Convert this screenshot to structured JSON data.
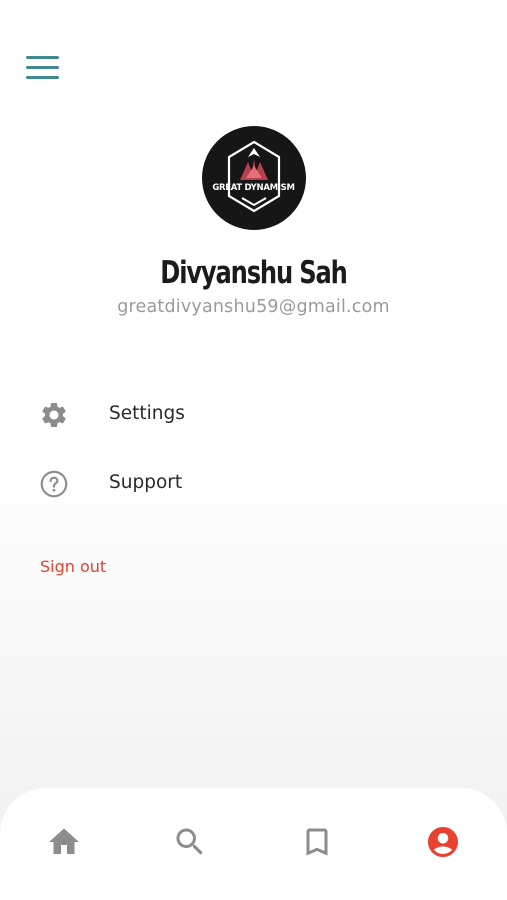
{
  "profile": {
    "name": "Divyanshu Sah",
    "email": "greatdivyanshu59@gmail.com",
    "avatar_text": "GREAT DYNAMISM"
  },
  "menu": {
    "items": [
      {
        "label": "Settings",
        "icon": "gear-icon"
      },
      {
        "label": "Support",
        "icon": "help-circle-icon"
      }
    ],
    "sign_out_label": "Sign out"
  },
  "bottom_nav": {
    "items": [
      {
        "icon": "home-icon",
        "active": false
      },
      {
        "icon": "search-icon",
        "active": false
      },
      {
        "icon": "bookmark-icon",
        "active": false
      },
      {
        "icon": "account-icon",
        "active": true
      }
    ]
  },
  "colors": {
    "accent": "#e8412f",
    "menu_icon": "#3f8a92",
    "inactive_icon": "#8c8c8c",
    "text": "#2a2a2a",
    "muted_text": "#9a9a9a"
  }
}
